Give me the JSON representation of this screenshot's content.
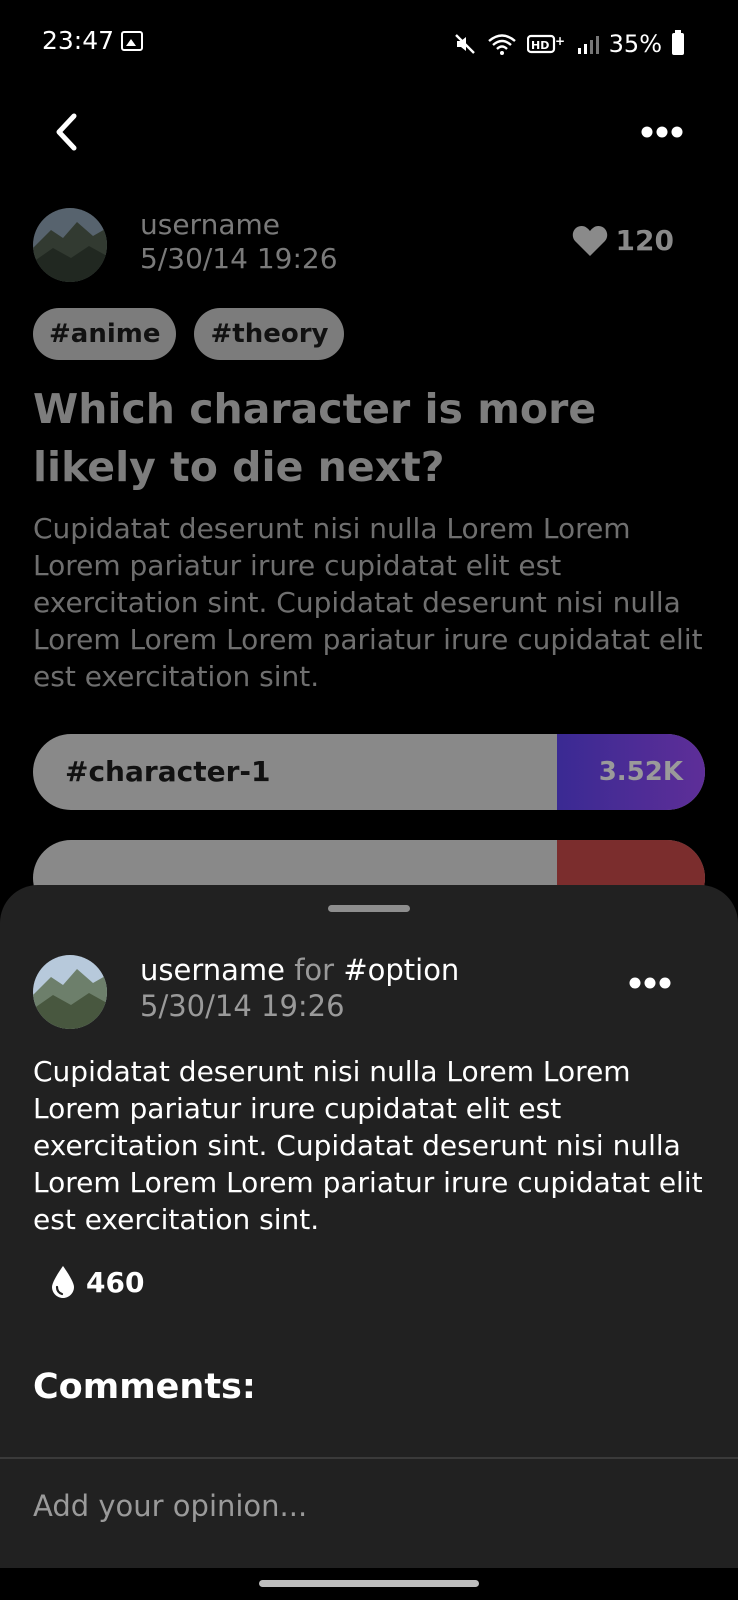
{
  "status_bar": {
    "time": "23:47",
    "battery": "35%",
    "icons": [
      "image-icon",
      "mute-icon",
      "wifi-icon",
      "hd-voice-icon",
      "signal-icon",
      "battery-icon"
    ]
  },
  "header": {
    "back_icon": "chevron-left-icon",
    "more_icon": "more-horizontal-icon"
  },
  "post": {
    "username": "username",
    "date": "5/30/14 19:26",
    "likes": "120",
    "tags": [
      "#anime",
      "#theory"
    ],
    "title": "Which character is more likely to die next?",
    "body": "Cupidatat deserunt nisi nulla Lorem Lorem Lorem pariatur irure cupidatat elit est exercitation sint. Cupidatat deserunt nisi nulla Lorem Lorem Lorem pariatur irure cupidatat elit est exercitation sint.",
    "options": [
      {
        "label": "#character-1",
        "count": "3.52K",
        "share": 0.22,
        "color": "#3a2a93"
      },
      {
        "label": "",
        "count": "",
        "share": 0.22,
        "color": "#7b2d2d"
      }
    ]
  },
  "sheet": {
    "username": "username",
    "for_text": "for",
    "option": "#option",
    "date": "5/30/14 19:26",
    "body": "Cupidatat deserunt nisi nulla Lorem Lorem Lorem pariatur irure cupidatat elit est exercitation sint. Cupidatat deserunt nisi nulla Lorem Lorem Lorem pariatur irure cupidatat elit est exercitation sint.",
    "drops": "460",
    "comments_title": "Comments:",
    "input_placeholder": "Add your opinion..."
  }
}
